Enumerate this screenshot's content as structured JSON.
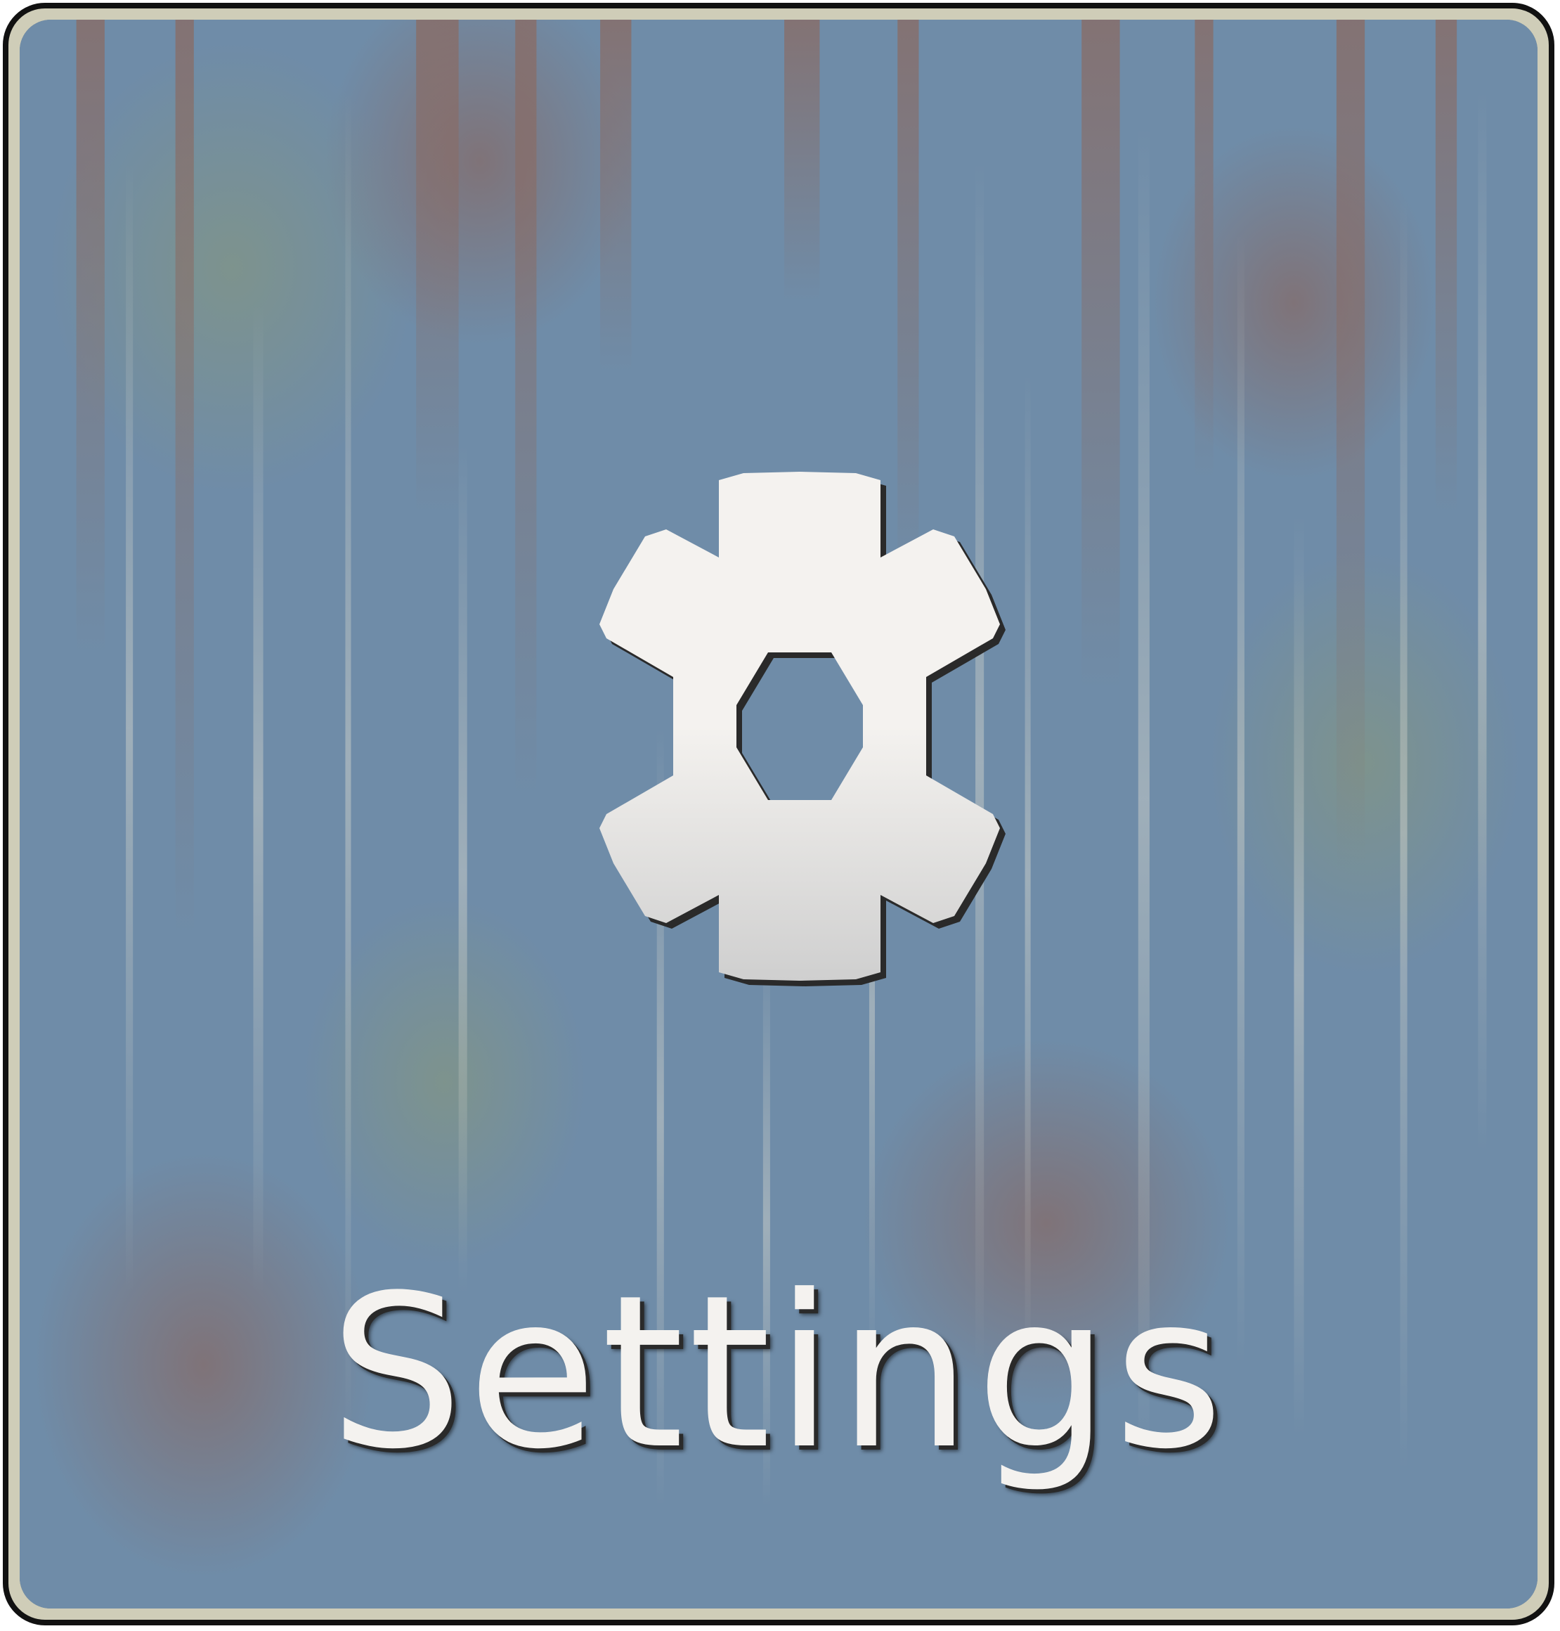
{
  "tile": {
    "label": "Settings",
    "icon": "gear-icon",
    "background_color": "#6f8ca8",
    "border_color": "#cfcdb8",
    "text_color": "#f4f2ef"
  }
}
